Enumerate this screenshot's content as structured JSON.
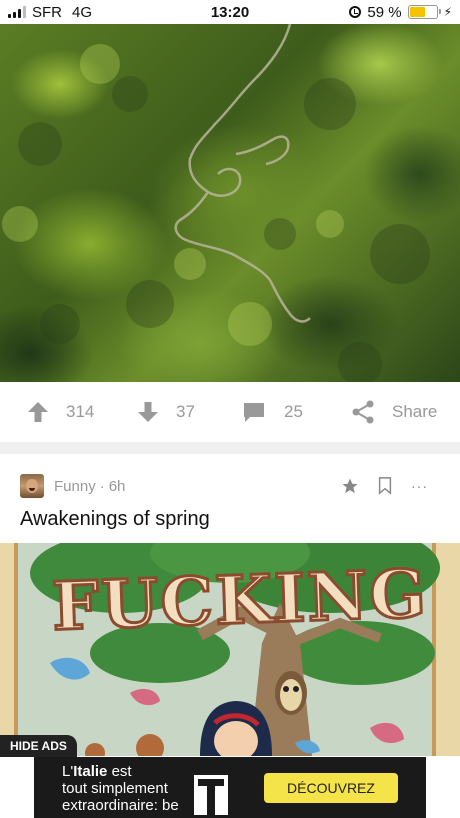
{
  "status_bar": {
    "carrier": "SFR",
    "network": "4G",
    "time": "13:20",
    "battery_percent": "59 %",
    "battery_level": 0.59
  },
  "post1": {
    "upvotes": "314",
    "downvotes": "37",
    "comments": "25",
    "share_label": "Share"
  },
  "post2": {
    "section": "Funny",
    "separator": "·",
    "age": "6h",
    "title": "Awakenings of spring",
    "more_label": "···",
    "image_text": "FUCKING"
  },
  "ad": {
    "hide_label": "HIDE ADS",
    "line1_prefix": "L'",
    "line1_bold": "Italie",
    "line1_suffix": " est",
    "line2": "tout simplement",
    "line3": "extraordinaire: be",
    "cta": "DÉCOUVREZ"
  },
  "colors": {
    "accent_battery": "#f5c400",
    "action_gray": "#999999",
    "cta_yellow": "#f5e34a"
  }
}
